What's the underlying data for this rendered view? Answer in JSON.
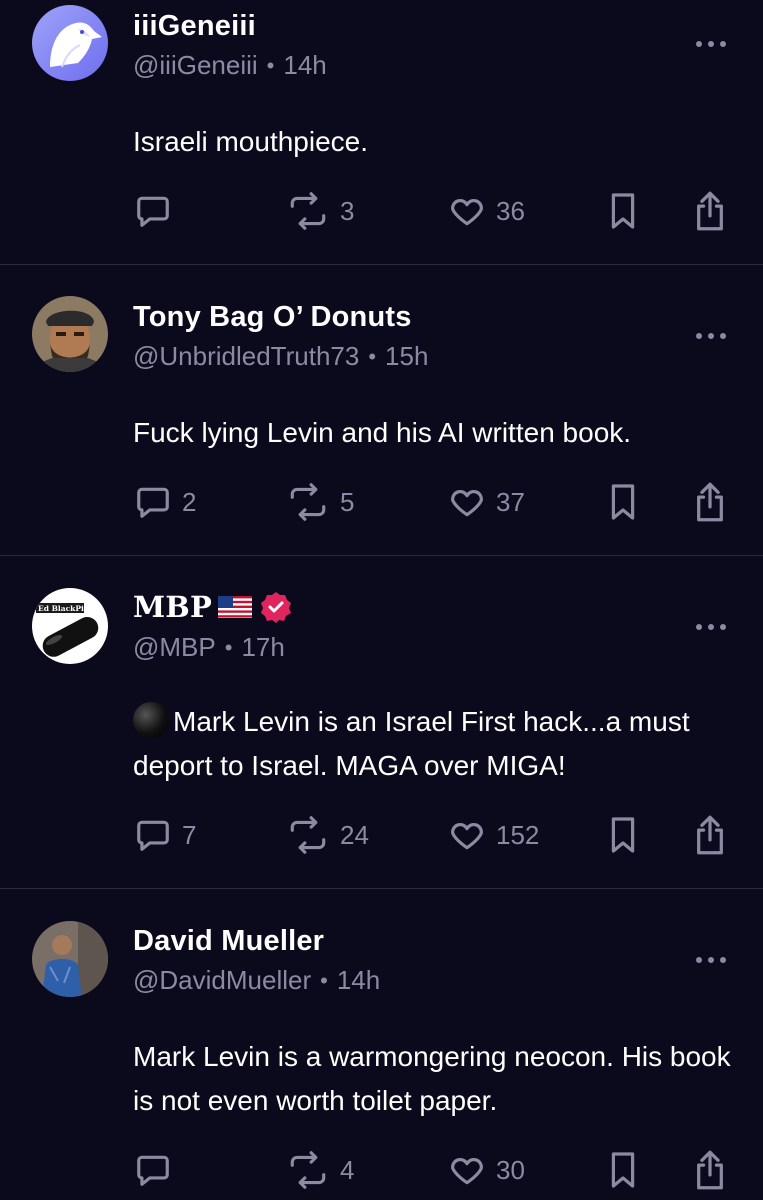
{
  "posts": [
    {
      "name": "iiiGeneiii",
      "handle": "@iiiGeneiii",
      "time": "14h",
      "text": "Israeli mouthpiece.",
      "replies": "",
      "reposts": "3",
      "likes": "36",
      "avatar": "eagle-avatar"
    },
    {
      "name": "Tony Bag O’ Donuts",
      "handle": "@UnbridledTruth73",
      "time": "15h",
      "text": "Fuck lying Levin and his AI written book.",
      "replies": "2",
      "reposts": "5",
      "likes": "37",
      "avatar": "bearded-man-avatar"
    },
    {
      "name": "MBP",
      "handle": "@MBP",
      "time": "17h",
      "text": "Mark Levin is an Israel First hack...a must deport to Israel. MAGA over MIGA!",
      "replies": "7",
      "reposts": "24",
      "likes": "152",
      "avatar": "black-pill-avatar",
      "avatar_text": "Ed BlackPill",
      "flag": "us-flag-icon",
      "verified": "verified-badge-icon"
    },
    {
      "name": "David Mueller",
      "handle": "@DavidMueller",
      "time": "14h",
      "text": "Mark Levin is a warmongering neocon. His book is not even worth toilet paper.",
      "replies": "",
      "reposts": "4",
      "likes": "30",
      "avatar": "man-photo-avatar"
    }
  ],
  "separator": "•",
  "colors": {
    "background": "#0b0a1d",
    "text": "#ffffff",
    "muted": "#8b8aa2",
    "divider": "#2a2940",
    "verified": "#e0245e"
  }
}
